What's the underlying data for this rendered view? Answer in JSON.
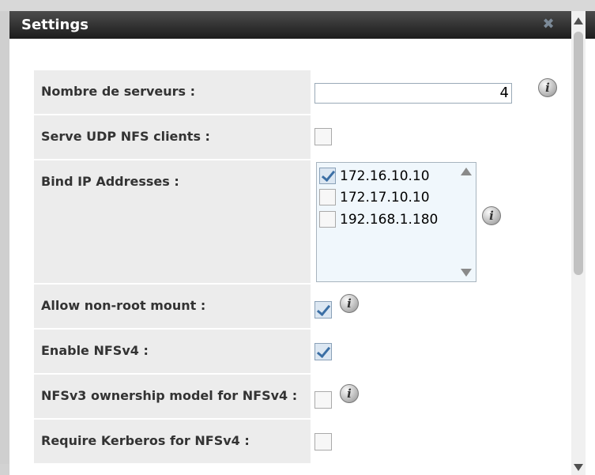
{
  "dialog": {
    "title": "Settings",
    "close_icon": "close-x-icon"
  },
  "fields": {
    "servers": {
      "label": "Nombre de serveurs :",
      "value": "4"
    },
    "udp": {
      "label": "Serve UDP NFS clients :",
      "checked": false
    },
    "bind_ip": {
      "label": "Bind IP Addresses :",
      "options": [
        {
          "address": "172.16.10.10",
          "checked": true
        },
        {
          "address": "172.17.10.10",
          "checked": false
        },
        {
          "address": "192.168.1.180",
          "checked": false
        }
      ]
    },
    "non_root": {
      "label": "Allow non-root mount :",
      "checked": true
    },
    "nfsv4": {
      "label": "Enable NFSv4 :",
      "checked": true
    },
    "v3_ownership": {
      "label": "NFSv3 ownership model for NFSv4 :",
      "checked": false
    },
    "kerberos": {
      "label": "Require Kerberos for NFSv4 :",
      "checked": false
    }
  },
  "info_icon_glyph": "i",
  "colors": {
    "titlebar": "#1c1c1c",
    "label_bg": "#ececec",
    "list_bg": "#f0f7fc",
    "check_accent": "#3b6fa5"
  }
}
